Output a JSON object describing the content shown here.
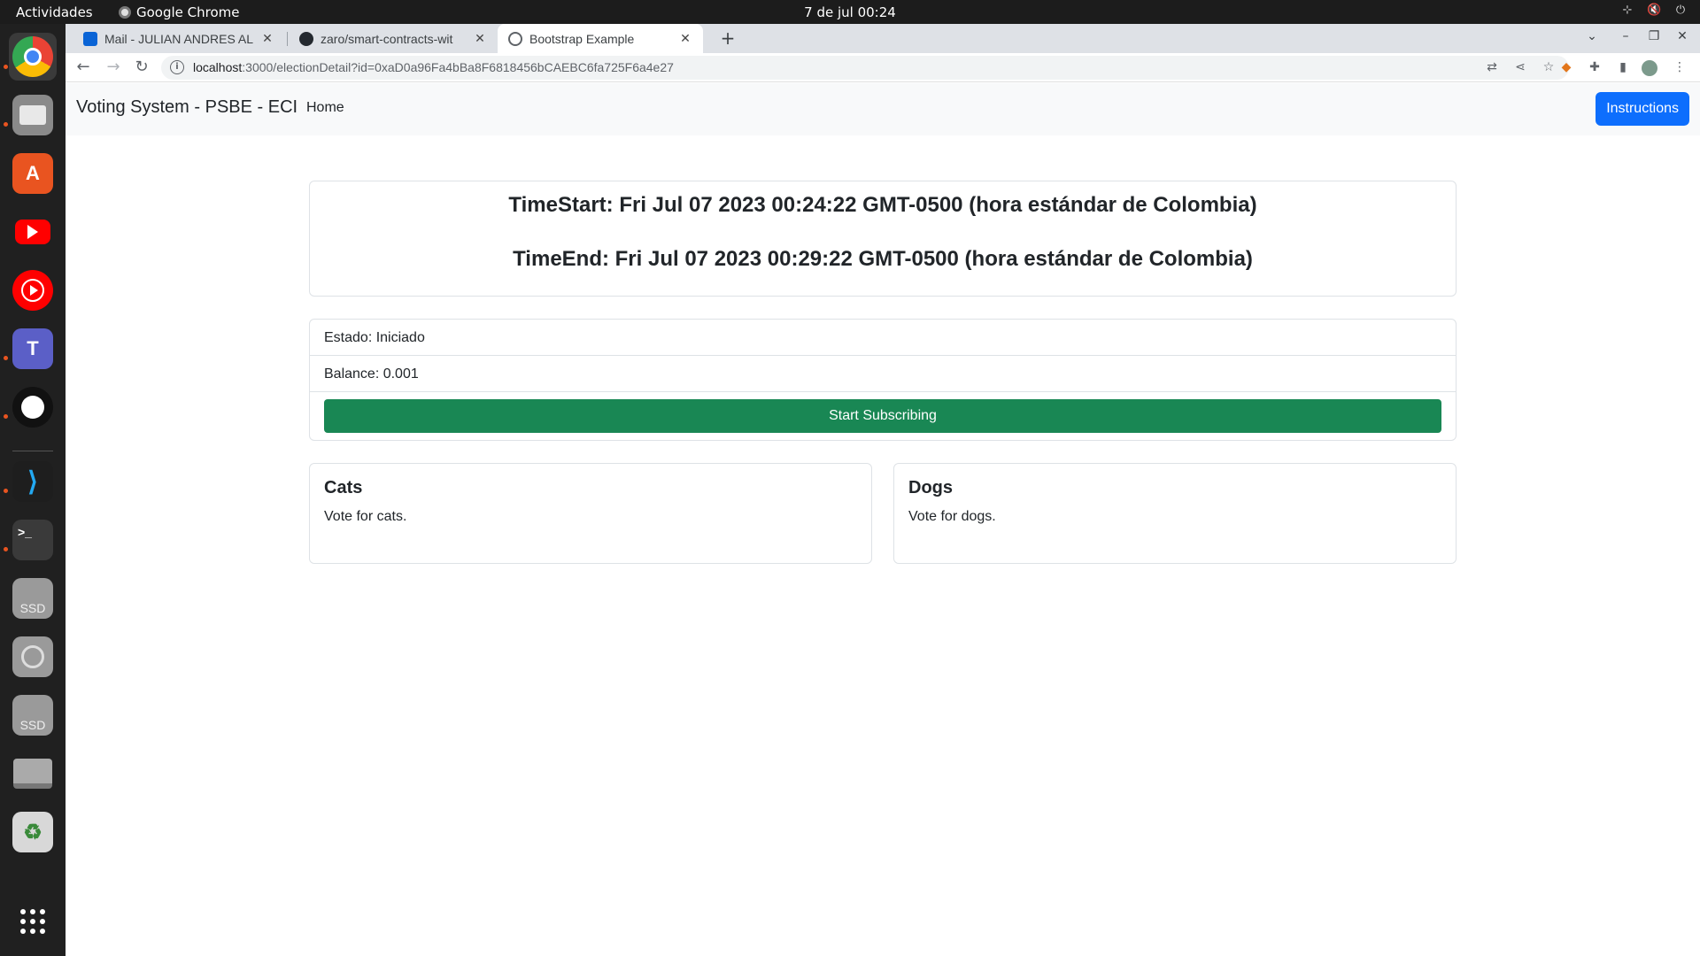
{
  "system": {
    "activities": "Actividades",
    "app_name": "Google Chrome",
    "clock": "7 de jul  00:24"
  },
  "dock": {
    "apps": [
      "Google Chrome",
      "Files",
      "Ubuntu Software",
      "YouTube",
      "YouTube Music",
      "Microsoft Teams",
      "GitHub Desktop",
      "Visual Studio Code",
      "Terminal",
      "SSD drive",
      "Optical drive",
      "SSD drive",
      "Disk",
      "Trash",
      "Show Applications"
    ],
    "ssd_label": "SSD"
  },
  "browser": {
    "tabs": [
      {
        "title": "Mail - JULIAN ANDRES AL",
        "active": false
      },
      {
        "title": "zaro/smart-contracts-wit",
        "active": false
      },
      {
        "title": "Bootstrap Example",
        "active": true
      }
    ],
    "url_host": "localhost",
    "url_rest": ":3000/electionDetail?id=0xaD0a96Fa4bBa8F6818456bCAEBC6fa725F6a4e27"
  },
  "page": {
    "brand": "Voting System - PSBE - ECI",
    "nav_home": "Home",
    "instructions_button": "Instructions",
    "time_start": "TimeStart: Fri Jul 07 2023 00:24:22 GMT-0500 (hora estándar de Colombia)",
    "time_end": "TimeEnd: Fri Jul 07 2023 00:29:22 GMT-0500 (hora estándar de Colombia)",
    "estado": "Estado: Iniciado",
    "balance": "Balance: 0.001",
    "subscribe_button": "Start Subscribing",
    "options": [
      {
        "title": "Cats",
        "text": "Vote for cats."
      },
      {
        "title": "Dogs",
        "text": "Vote for dogs."
      }
    ]
  },
  "colors": {
    "primary": "#0d6efd",
    "success": "#198754",
    "navbar_bg": "#f8f9fa"
  }
}
